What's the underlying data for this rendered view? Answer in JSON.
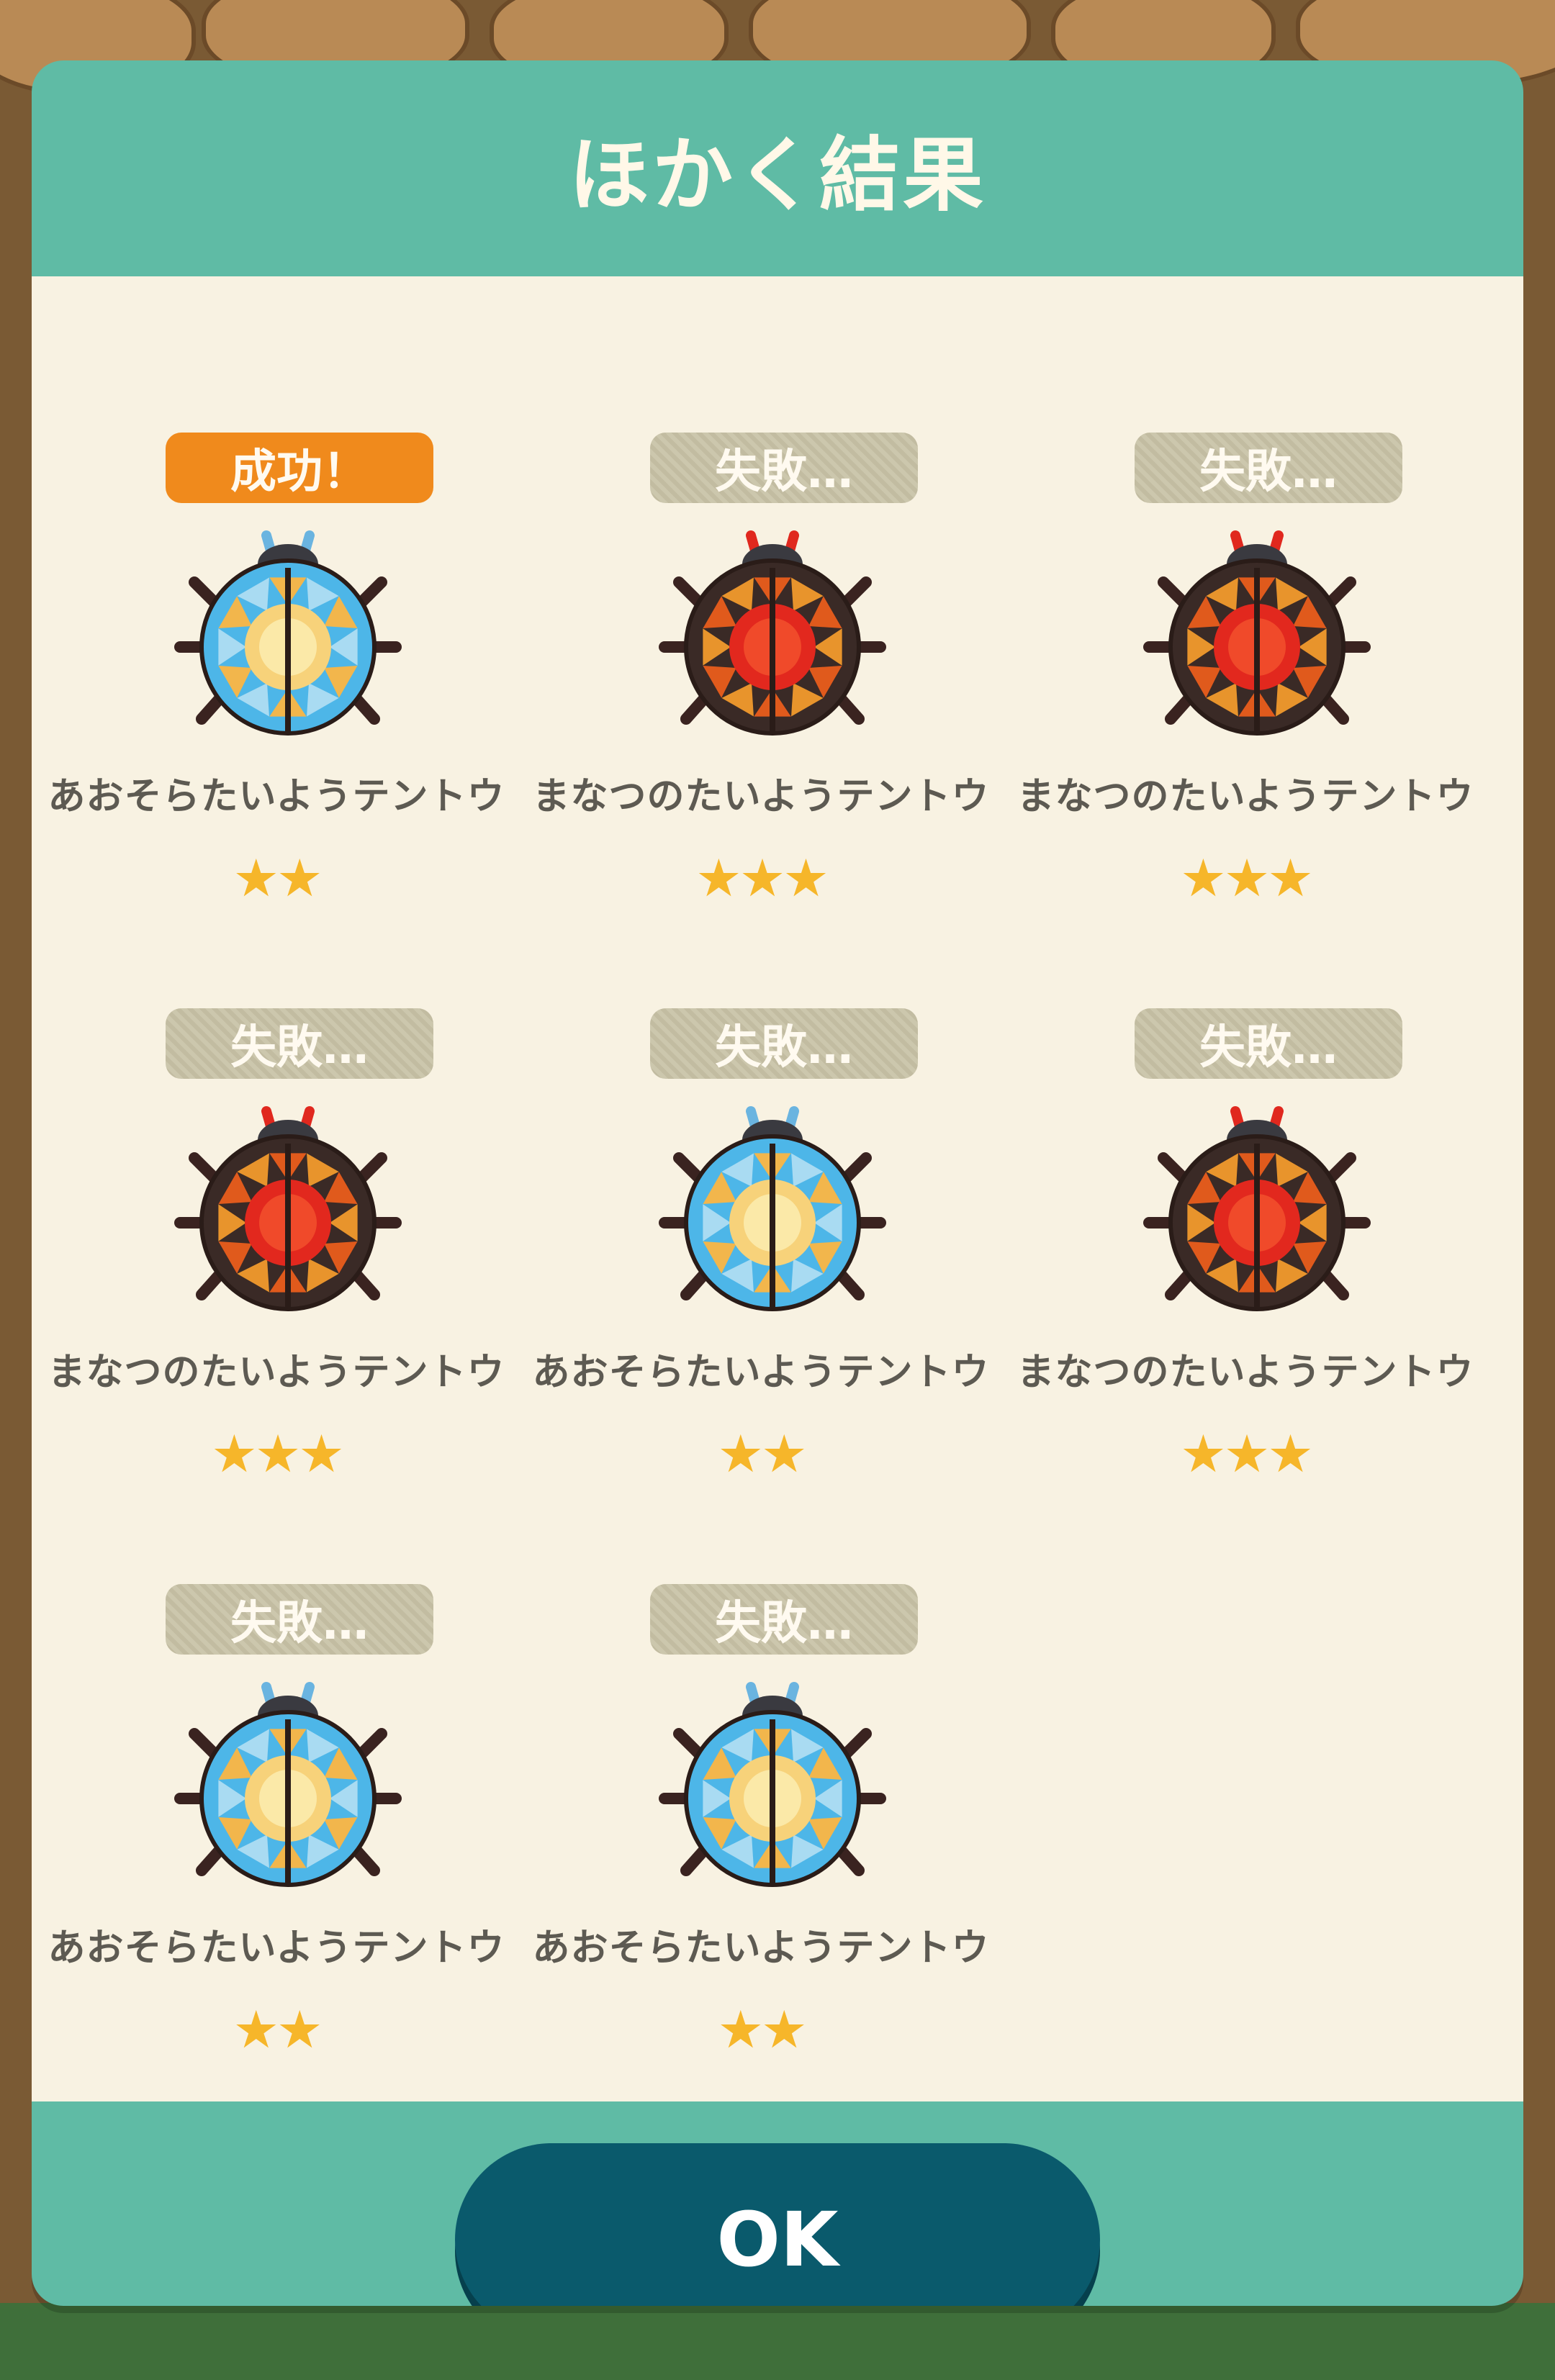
{
  "dialog": {
    "title": "ほかく結果",
    "ok_label": "OK"
  },
  "results": [
    {
      "status": "成功！",
      "success": true,
      "name": "あおそらたいようテントウ",
      "stars": "★★",
      "variant": "blue"
    },
    {
      "status": "失敗…",
      "success": false,
      "name": "まなつのたいようテントウ",
      "stars": "★★★",
      "variant": "red"
    },
    {
      "status": "失敗…",
      "success": false,
      "name": "まなつのたいようテントウ",
      "stars": "★★★",
      "variant": "red"
    },
    {
      "status": "失敗…",
      "success": false,
      "name": "まなつのたいようテントウ",
      "stars": "★★★",
      "variant": "red"
    },
    {
      "status": "失敗…",
      "success": false,
      "name": "あおそらたいようテントウ",
      "stars": "★★",
      "variant": "blue"
    },
    {
      "status": "失敗…",
      "success": false,
      "name": "まなつのたいようテントウ",
      "stars": "★★★",
      "variant": "red"
    },
    {
      "status": "失敗…",
      "success": false,
      "name": "あおそらたいようテントウ",
      "stars": "★★",
      "variant": "blue"
    },
    {
      "status": "失敗…",
      "success": false,
      "name": "あおそらたいようテントウ",
      "stars": "★★",
      "variant": "blue"
    }
  ],
  "colors": {
    "header": "#5fbba5",
    "panel": "#f8f2e2",
    "success_badge": "#f08a1c",
    "fail_badge": "#c8c2a6",
    "star": "#f6b62a",
    "ok_button": "#0a5a6c"
  }
}
